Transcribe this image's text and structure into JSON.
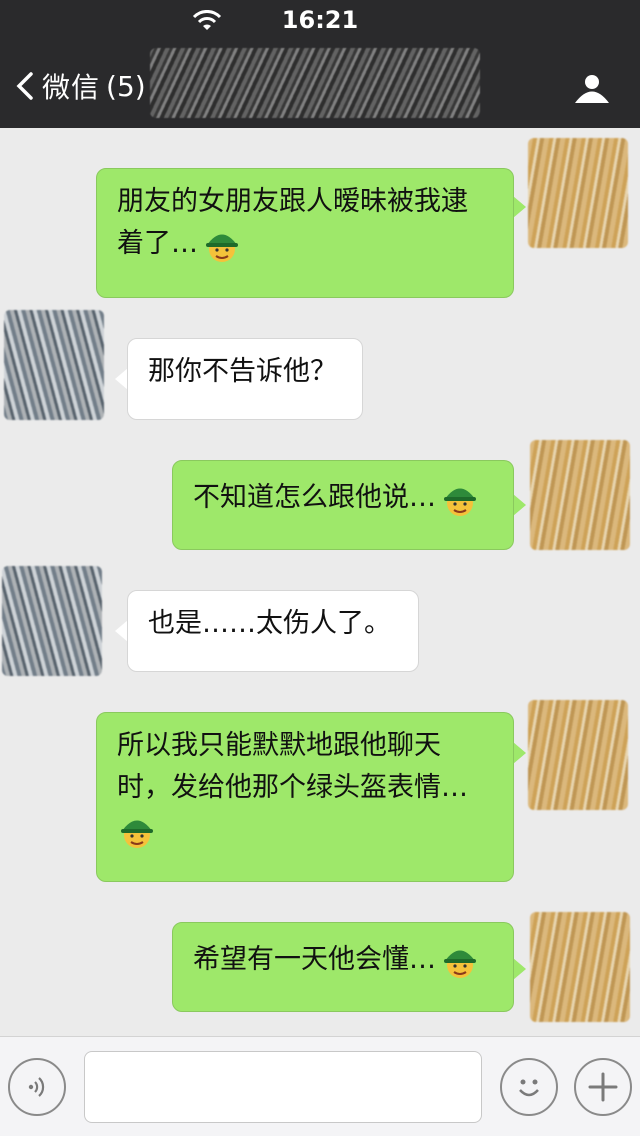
{
  "status_bar": {
    "time": "16:21"
  },
  "nav": {
    "back_label": "微信",
    "unread_count": "(5)"
  },
  "messages": [
    {
      "side": "out",
      "line1": "朋友的女朋友跟人暧昧被我逮",
      "line2": "着了…",
      "emoji": "green-hat-emoji"
    },
    {
      "side": "in",
      "text": "那你不告诉他？"
    },
    {
      "side": "out",
      "text": "不知道怎么跟他说…",
      "emoji": "green-hat-emoji"
    },
    {
      "side": "in",
      "text": "也是……太伤人了。"
    },
    {
      "side": "out",
      "line1": "所以我只能默默地跟他聊天",
      "line2": "时，发给他那个绿头盔表情…",
      "emoji": "green-hat-emoji"
    },
    {
      "side": "out",
      "text": "希望有一天他会懂…",
      "emoji": "green-hat-emoji"
    }
  ],
  "input_bar": {
    "text_value": ""
  },
  "colors": {
    "outgoing_bubble": "#9ee86a",
    "incoming_bubble": "#ffffff",
    "nav_bg": "#2a2a2c",
    "chat_bg": "#ebebeb"
  }
}
